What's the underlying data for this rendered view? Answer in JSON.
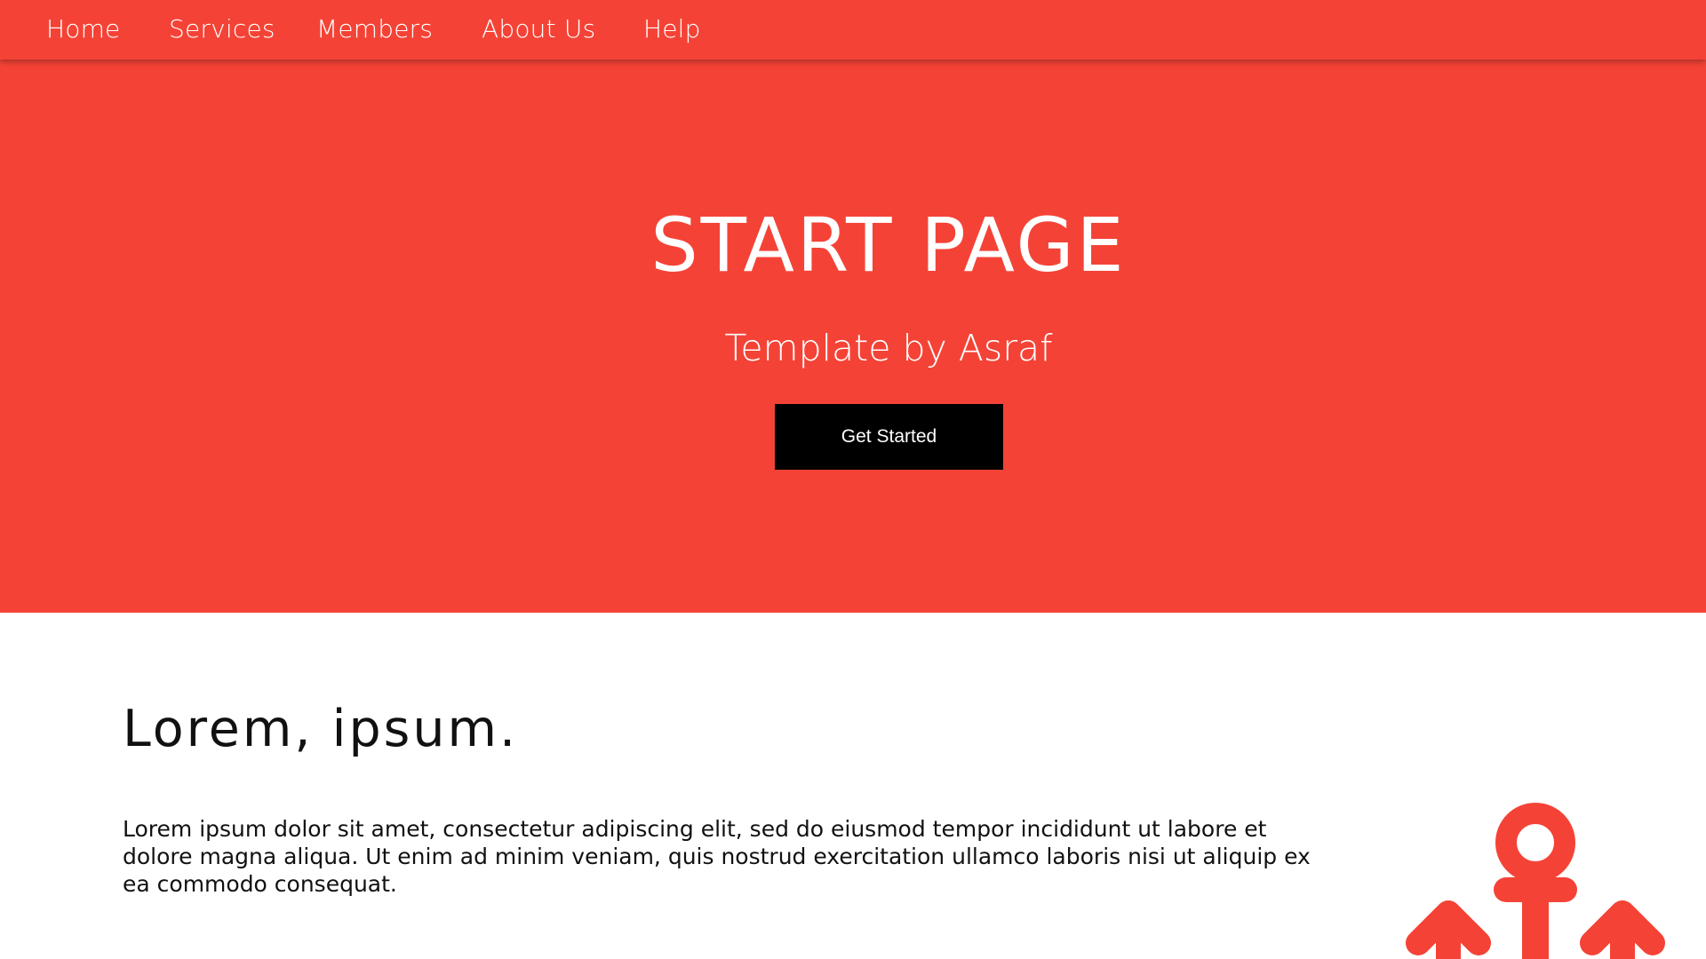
{
  "nav": {
    "items": [
      {
        "label": "Home"
      },
      {
        "label": "Services"
      },
      {
        "label": "Members"
      },
      {
        "label": "About Us"
      },
      {
        "label": "Help"
      }
    ]
  },
  "hero": {
    "title": "START PAGE",
    "subtitle": "Template by Asraf",
    "cta_label": "Get Started"
  },
  "content": {
    "heading": "Lorem, ipsum.",
    "body": "Lorem ipsum dolor sit amet, consectetur adipiscing elit, sed do eiusmod tempor incididunt ut labore et dolore magna aliqua. Ut enim ad minim veniam, quis nostrud exercitation ullamco laboris nisi ut aliquip ex ea commodo consequat."
  },
  "illustration": {
    "icon": "anchor-icon",
    "color": "#f44336"
  },
  "colors": {
    "brand": "#f44336",
    "button": "#000000",
    "text_light": "#ffffff",
    "text_dark": "#111111"
  }
}
